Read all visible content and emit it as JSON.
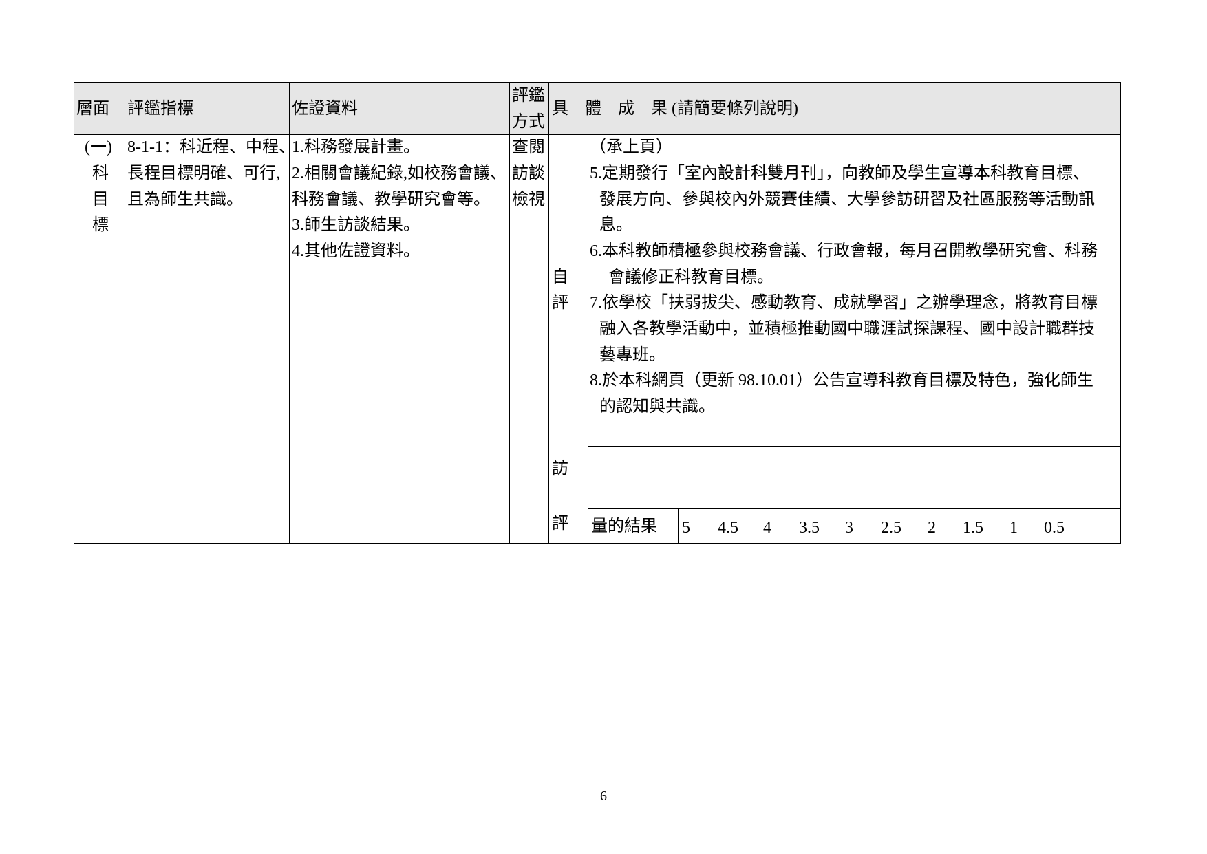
{
  "header": {
    "col_level": "層面",
    "col_indicator": "評鑑指標",
    "col_evidence": "佐證資料",
    "col_method_line1": "評鑑",
    "col_method_line2": "方式",
    "col_results": "具　體　成　果 (請簡要條列說明)"
  },
  "row": {
    "level_lines": [
      "(一)",
      "科",
      "目",
      "標"
    ],
    "indicator_lines": [
      "8-1-1：科近程、中程、",
      "長程目標明確、可行,",
      "且為師生共識。"
    ],
    "evidence_lines": [
      "1.科務發展計畫。",
      "2.相關會議紀錄,如校務會議、",
      "科務會議、教學研究會等。",
      "3.師生訪談結果。",
      "4.其他佐證資料。"
    ],
    "method_lines": [
      "查閱",
      "訪談",
      "檢視"
    ],
    "self_eval_label": [
      "自",
      "評"
    ],
    "interview_label": [
      "訪",
      "評"
    ],
    "self_eval_lines": [
      "（承上頁）",
      "5.定期發行「室內設計科雙月刊」，向教師及學生宣導本科教育目標、",
      "發展方向、參與校內外競賽佳績、大學參訪研習及社區服務等活動訊",
      "息。",
      "6.本科教師積極參與校務會議、行政會報，每月召開教學研究會、科務",
      "會議修正科教育目標。",
      "7.依學校「扶弱拔尖、感動教育、成就學習」之辦學理念，將教育目標",
      "融入各教學活動中，並積極推動國中職涯試探課程、國中設計職群技",
      "藝專班。",
      "8.於本科網頁（更新 98.10.01）公告宣導科教育目標及特色，強化師生",
      "的認知與共識。"
    ],
    "quant_label": "量的結果",
    "quant_values": [
      "5",
      "4.5",
      "4",
      "3.5",
      "3",
      "2.5",
      "2",
      "1.5",
      "1",
      "0.5"
    ]
  },
  "page_number": "6"
}
